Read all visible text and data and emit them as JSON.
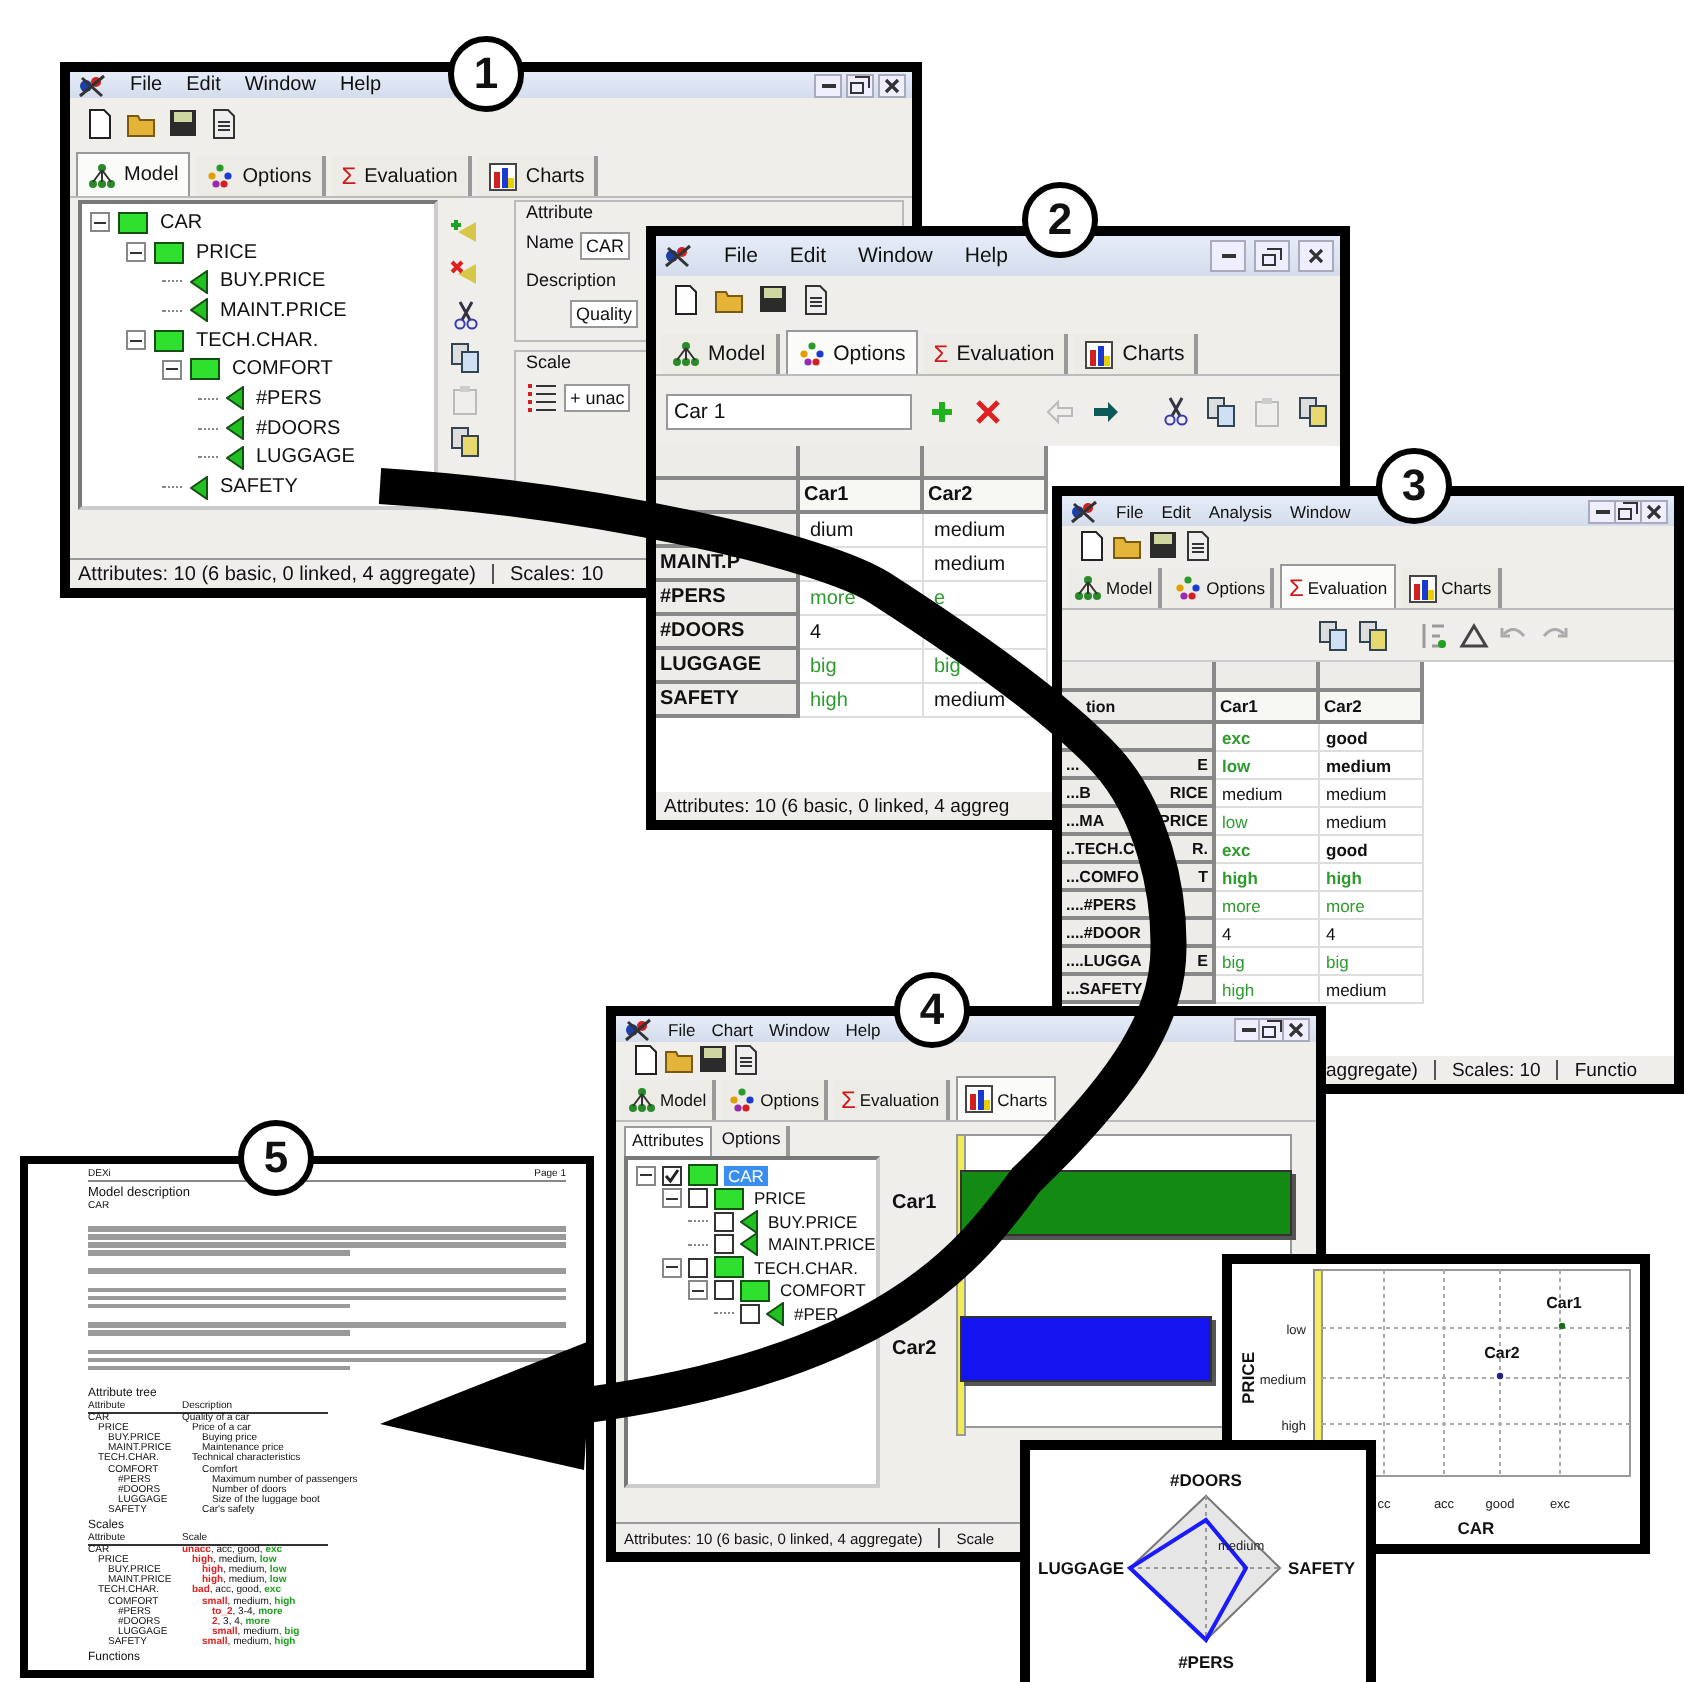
{
  "callouts": [
    "1",
    "2",
    "3",
    "4",
    "5"
  ],
  "windows": [
    {
      "kind": "model",
      "menu": [
        "File",
        "Edit",
        "Window",
        "Help"
      ],
      "tabs": [
        {
          "label": "Model",
          "selected": true
        },
        {
          "label": "Options",
          "selected": false
        },
        {
          "label": "Evaluation",
          "glyph": "Σ",
          "selected": false
        },
        {
          "label": "Charts",
          "selected": false
        }
      ],
      "tree": [
        {
          "label": "CAR",
          "kind": "aggregate",
          "expanded": true,
          "children": [
            {
              "label": "PRICE",
              "kind": "aggregate",
              "expanded": true,
              "children": [
                {
                  "label": "BUY.PRICE",
                  "kind": "basic"
                },
                {
                  "label": "MAINT.PRICE",
                  "kind": "basic"
                }
              ]
            },
            {
              "label": "TECH.CHAR.",
              "kind": "aggregate",
              "expanded": true,
              "children": [
                {
                  "label": "COMFORT",
                  "kind": "aggregate",
                  "expanded": true,
                  "children": [
                    {
                      "label": "#PERS",
                      "kind": "basic"
                    },
                    {
                      "label": "#DOORS",
                      "kind": "basic"
                    },
                    {
                      "label": "LUGGAGE",
                      "kind": "basic"
                    }
                  ]
                },
                {
                  "label": "SAFETY",
                  "kind": "basic"
                }
              ]
            }
          ]
        }
      ],
      "attribute": {
        "title": "Attribute",
        "name_label": "Name",
        "name_value": "CAR",
        "description_label": "Description",
        "description_value": "Quality"
      },
      "scale": {
        "title": "Scale",
        "value": "+ unac"
      },
      "status": [
        "Attributes: 10 (6 basic, 0 linked, 4 aggregate)",
        "Scales: 10"
      ]
    },
    {
      "kind": "options",
      "menu": [
        "File",
        "Edit",
        "Window",
        "Help"
      ],
      "tabs": [
        {
          "label": "Model",
          "selected": false
        },
        {
          "label": "Options",
          "selected": true
        },
        {
          "label": "Evaluation",
          "glyph": "Σ",
          "selected": false
        },
        {
          "label": "Charts",
          "selected": false
        }
      ],
      "option_name": "Car 1",
      "table": {
        "columns": [
          "Car1",
          "Car2"
        ],
        "rows": [
          {
            "cells": [
              {
                "text": "dium"
              },
              {
                "text": "medium"
              }
            ]
          },
          {
            "label": "MAINT.P",
            "cells": [
              null,
              {
                "text": "medium"
              }
            ]
          },
          {
            "label": "#PERS",
            "cells": [
              {
                "text": "more",
                "color": "#2e9b2e"
              },
              {
                "text": "e",
                "color": "#2e9b2e"
              }
            ]
          },
          {
            "label": "#DOORS",
            "cells": [
              {
                "text": "4"
              },
              null
            ]
          },
          {
            "label": "LUGGAGE",
            "cells": [
              {
                "text": "big",
                "color": "#2e9b2e"
              },
              {
                "text": "big",
                "color": "#2e9b2e"
              }
            ]
          },
          {
            "label": "SAFETY",
            "cells": [
              {
                "text": "high",
                "color": "#2e9b2e"
              },
              {
                "text": "medium"
              }
            ]
          }
        ]
      },
      "status": [
        "Attributes: 10 (6 basic, 0 linked, 4 aggreg"
      ]
    },
    {
      "kind": "evaluation",
      "menu": [
        "File",
        "Edit",
        "Analysis",
        "Window"
      ],
      "tabs": [
        {
          "label": "Model",
          "selected": false
        },
        {
          "label": "Options",
          "selected": false
        },
        {
          "label": "Evaluation",
          "glyph": "Σ",
          "selected": true
        },
        {
          "label": "Charts",
          "selected": false
        }
      ],
      "table": {
        "corner": "tion",
        "columns": [
          "Car1",
          "Car2"
        ],
        "rows": [
          {
            "label_parts": [],
            "cells": [
              {
                "text": "exc",
                "color": "#2e9b2e",
                "bold": true
              },
              {
                "text": "good",
                "bold": true
              }
            ]
          },
          {
            "label_parts": [
              "...",
              "E"
            ],
            "cells": [
              {
                "text": "low",
                "color": "#2e9b2e",
                "bold": true
              },
              {
                "text": "medium",
                "bold": true
              }
            ]
          },
          {
            "label_parts": [
              "...B",
              "RICE"
            ],
            "cells": [
              {
                "text": "medium"
              },
              {
                "text": "medium"
              }
            ]
          },
          {
            "label_parts": [
              "...MA",
              "PRICE"
            ],
            "cells": [
              {
                "text": "low",
                "color": "#2e9b2e"
              },
              {
                "text": "medium"
              }
            ]
          },
          {
            "label_parts": [
              "..TECH.C",
              "R."
            ],
            "cells": [
              {
                "text": "exc",
                "color": "#2e9b2e",
                "bold": true
              },
              {
                "text": "good",
                "bold": true
              }
            ]
          },
          {
            "label_parts": [
              "...COMFO",
              "T"
            ],
            "cells": [
              {
                "text": "high",
                "color": "#2e9b2e",
                "bold": true
              },
              {
                "text": "high",
                "color": "#2e9b2e",
                "bold": true
              }
            ]
          },
          {
            "label_parts": [
              "....#PERS"
            ],
            "cells": [
              {
                "text": "more",
                "color": "#2e9b2e"
              },
              {
                "text": "more",
                "color": "#2e9b2e"
              }
            ]
          },
          {
            "label_parts": [
              "....#DOOR"
            ],
            "cells": [
              {
                "text": "4"
              },
              {
                "text": "4"
              }
            ]
          },
          {
            "label_parts": [
              "....LUGGA",
              "E"
            ],
            "cells": [
              {
                "text": "big",
                "color": "#2e9b2e"
              },
              {
                "text": "big",
                "color": "#2e9b2e"
              }
            ]
          },
          {
            "label_parts": [
              "...SAFETY"
            ],
            "cells": [
              {
                "text": "high",
                "color": "#2e9b2e"
              },
              {
                "text": "medium"
              }
            ]
          }
        ]
      },
      "status": [
        "aggregate)",
        "Scales: 10",
        "Functio"
      ]
    },
    {
      "kind": "charts",
      "menu": [
        "File",
        "Chart",
        "Window",
        "Help"
      ],
      "tabs": [
        {
          "label": "Model",
          "selected": false
        },
        {
          "label": "Options",
          "selected": false
        },
        {
          "label": "Evaluation",
          "glyph": "Σ",
          "selected": false
        },
        {
          "label": "Charts",
          "selected": true
        }
      ],
      "subtabs": [
        {
          "label": "Attributes",
          "selected": true
        },
        {
          "label": "Options",
          "selected": false
        }
      ],
      "tree": [
        {
          "label": "CAR",
          "kind": "aggregate",
          "expanded": true,
          "checked": true,
          "selected": true,
          "children": [
            {
              "label": "PRICE",
              "kind": "aggregate",
              "expanded": true,
              "checked": false,
              "selected": false,
              "children": [
                {
                  "label": "BUY.PRICE",
                  "kind": "basic",
                  "checked": false,
                  "selected": false
                },
                {
                  "label": "MAINT.PRICE",
                  "kind": "basic",
                  "checked": false,
                  "selected": false
                }
              ]
            },
            {
              "label": "TECH.CHAR.",
              "kind": "aggregate",
              "expanded": true,
              "checked": false,
              "selected": false,
              "children": [
                {
                  "label": "COMFORT",
                  "kind": "aggregate",
                  "expanded": true,
                  "checked": false,
                  "selected": false,
                  "children": [
                    {
                      "label": "#PER",
                      "kind": "basic",
                      "checked": false,
                      "selected": false
                    }
                  ]
                }
              ]
            }
          ]
        }
      ],
      "bars": [
        {
          "label": "Car1",
          "color": "#138a13"
        },
        {
          "label": "Car2",
          "color": "#1414f0"
        }
      ],
      "status": [
        "Attributes: 10 (6 basic, 0 linked, 4 aggregate)",
        "Scale"
      ]
    }
  ],
  "scatter": {
    "x_axis_title": "CAR",
    "y_axis_title": "PRICE",
    "x_labels": [
      "cc",
      "acc",
      "good",
      "exc"
    ],
    "y_labels": [
      "low",
      "medium",
      "high"
    ],
    "points": [
      {
        "label": "Car1",
        "color": "#1b6b1b"
      },
      {
        "label": "Car2",
        "color": "#23238f"
      }
    ]
  },
  "radar": {
    "axes": [
      "#DOORS",
      "SAFETY",
      "#PERS",
      "LUGGAGE"
    ],
    "tick_label": "medium"
  },
  "report": {
    "header": [
      "DEXi",
      "Page 1"
    ],
    "title": "Model description",
    "subtitle": "CAR",
    "attribute_tree": {
      "title": "Attribute tree",
      "columns": [
        "Attribute",
        "Description"
      ],
      "rows": [
        {
          "name": "CAR",
          "description": "Quality of a car",
          "children": [
            {
              "name": "PRICE",
              "description": "Price of a car",
              "children": [
                {
                  "name": "BUY.PRICE",
                  "description": "Buying price"
                },
                {
                  "name": "MAINT.PRICE",
                  "description": "Maintenance price"
                }
              ]
            },
            {
              "name": "TECH.CHAR.",
              "description": "Technical characteristics",
              "children": [
                {
                  "name": "COMFORT",
                  "description": "Comfort",
                  "children": [
                    {
                      "name": "#PERS",
                      "description": "Maximum number of passengers"
                    },
                    {
                      "name": "#DOORS",
                      "description": "Number of doors"
                    },
                    {
                      "name": "LUGGAGE",
                      "description": "Size of the luggage boot"
                    }
                  ]
                },
                {
                  "name": "SAFETY",
                  "description": "Car's safety"
                }
              ]
            }
          ]
        }
      ]
    },
    "scales": {
      "title": "Scales",
      "columns": [
        "Attribute",
        "Scale"
      ],
      "rows": [
        {
          "name": "CAR",
          "scale": [
            {
              "text": "unacc",
              "color": "#e02020"
            },
            {
              "text": ", acc, good, "
            },
            {
              "text": "exc",
              "color": "#20a020"
            }
          ],
          "children": [
            {
              "name": "PRICE",
              "scale": [
                {
                  "text": "high",
                  "color": "#e02020"
                },
                {
                  "text": ", medium, "
                },
                {
                  "text": "low",
                  "color": "#20a020"
                }
              ],
              "children": [
                {
                  "name": "BUY.PRICE",
                  "scale": [
                    {
                      "text": "high",
                      "color": "#e02020"
                    },
                    {
                      "text": ", medium, "
                    },
                    {
                      "text": "low",
                      "color": "#20a020"
                    }
                  ]
                },
                {
                  "name": "MAINT.PRICE",
                  "scale": [
                    {
                      "text": "high",
                      "color": "#e02020"
                    },
                    {
                      "text": ", medium, "
                    },
                    {
                      "text": "low",
                      "color": "#20a020"
                    }
                  ]
                }
              ]
            },
            {
              "name": "TECH.CHAR.",
              "scale": [
                {
                  "text": "bad",
                  "color": "#e02020"
                },
                {
                  "text": ", acc, good, "
                },
                {
                  "text": "exc",
                  "color": "#20a020"
                }
              ],
              "children": [
                {
                  "name": "COMFORT",
                  "scale": [
                    {
                      "text": "small",
                      "color": "#e02020"
                    },
                    {
                      "text": ", medium, "
                    },
                    {
                      "text": "high",
                      "color": "#20a020"
                    }
                  ],
                  "children": [
                    {
                      "name": "#PERS",
                      "scale": [
                        {
                          "text": "to_2",
                          "color": "#e02020"
                        },
                        {
                          "text": ", 3-4, "
                        },
                        {
                          "text": "more",
                          "color": "#20a020"
                        }
                      ]
                    },
                    {
                      "name": "#DOORS",
                      "scale": [
                        {
                          "text": "2",
                          "color": "#e02020"
                        },
                        {
                          "text": ", 3, 4, "
                        },
                        {
                          "text": "more",
                          "color": "#20a020"
                        }
                      ]
                    },
                    {
                      "name": "LUGGAGE",
                      "scale": [
                        {
                          "text": "small",
                          "color": "#e02020"
                        },
                        {
                          "text": ", medium, "
                        },
                        {
                          "text": "big",
                          "color": "#20a020"
                        }
                      ]
                    }
                  ]
                },
                {
                  "name": "SAFETY",
                  "scale": [
                    {
                      "text": "small",
                      "color": "#e02020"
                    },
                    {
                      "text": ", medium, "
                    },
                    {
                      "text": "high",
                      "color": "#20a020"
                    }
                  ]
                }
              ]
            }
          ]
        }
      ]
    },
    "footer_heading": "Functions"
  }
}
